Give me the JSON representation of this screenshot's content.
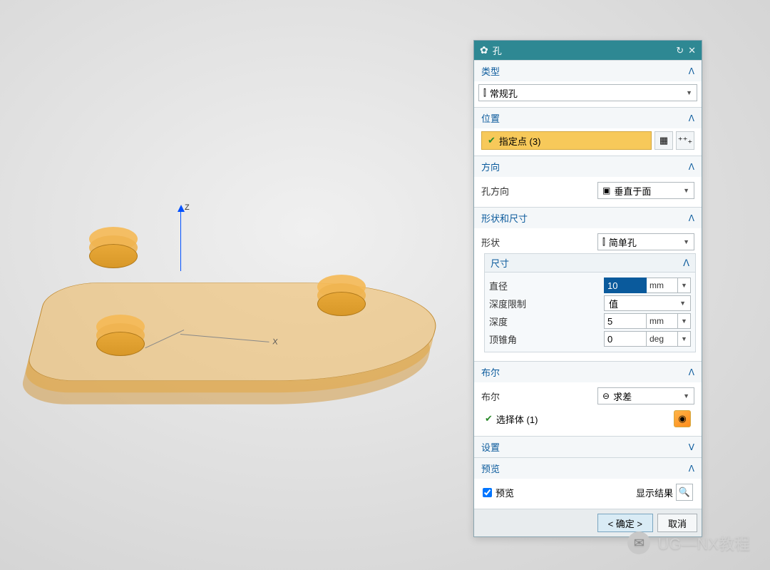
{
  "panel": {
    "title": "孔",
    "sections": {
      "type": {
        "label": "类型",
        "dropdown": "常规孔"
      },
      "position": {
        "label": "位置",
        "specify_points": "指定点 (3)"
      },
      "direction": {
        "label": "方向",
        "hole_dir_label": "孔方向",
        "hole_dir_value": "垂直于面"
      },
      "shape": {
        "label": "形状和尺寸",
        "shape_label": "形状",
        "shape_value": "简单孔",
        "dims_label": "尺寸",
        "diameter_label": "直径",
        "diameter_value": "10",
        "diameter_unit": "mm",
        "depth_limit_label": "深度限制",
        "depth_limit_value": "值",
        "depth_label": "深度",
        "depth_value": "5",
        "depth_unit": "mm",
        "tip_angle_label": "顶锥角",
        "tip_angle_value": "0",
        "tip_angle_unit": "deg"
      },
      "boolean": {
        "label": "布尔",
        "bool_label": "布尔",
        "bool_value": "求差",
        "select_body": "选择体 (1)"
      },
      "settings": {
        "label": "设置"
      },
      "preview": {
        "label": "预览",
        "checkbox_label": "预览",
        "show_result": "显示结果"
      }
    },
    "buttons": {
      "ok": "< 确定 >",
      "cancel": "取消"
    }
  },
  "watermark": "UG—NX教程"
}
